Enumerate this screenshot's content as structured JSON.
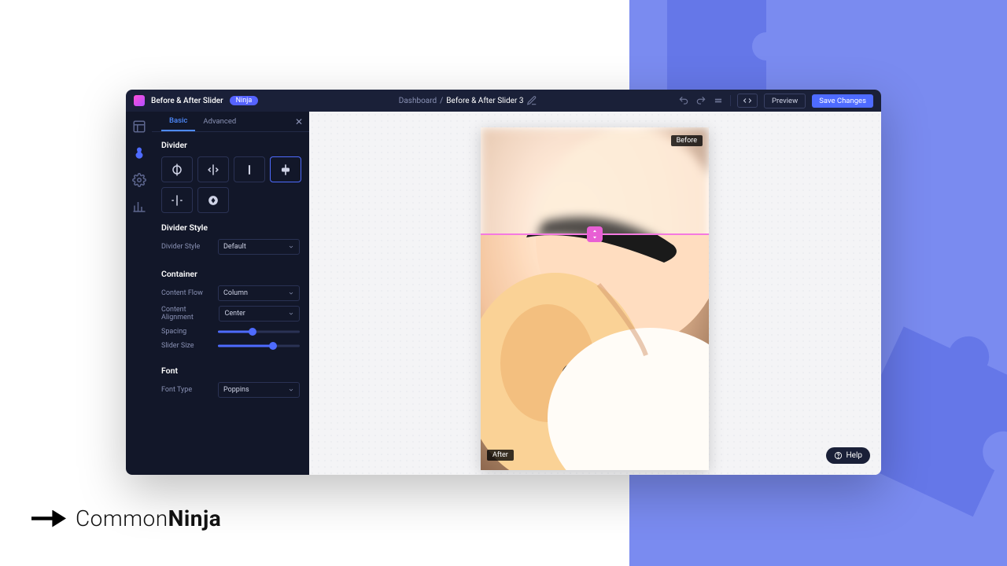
{
  "app": {
    "title": "Before & After Slider",
    "tag": "Ninja"
  },
  "breadcrumb": {
    "root": "Dashboard",
    "sep": "/",
    "current": "Before & After Slider 3"
  },
  "topbar": {
    "preview": "Preview",
    "save": "Save Changes"
  },
  "tabs": {
    "basic": "Basic",
    "advanced": "Advanced"
  },
  "panel": {
    "divider_title": "Divider",
    "divider_style_title": "Divider Style",
    "divider_style_label": "Divider Style",
    "divider_style_value": "Default",
    "container_title": "Container",
    "content_flow_label": "Content Flow",
    "content_flow_value": "Column",
    "content_alignment_label": "Content Alignment",
    "content_alignment_value": "Center",
    "spacing_label": "Spacing",
    "spacing_pct": 42,
    "slider_size_label": "Slider Size",
    "slider_size_pct": 67,
    "font_title": "Font",
    "font_type_label": "Font Type",
    "font_type_value": "Poppins",
    "divider_selected_index": 3
  },
  "preview": {
    "before_label": "Before",
    "after_label": "After",
    "handle_color": "#e85fd4"
  },
  "help": "Help",
  "brand": {
    "a": "Common",
    "b": "Ninja"
  },
  "colors": {
    "accent": "#4e6bff",
    "bg_right": "#7a8bf0",
    "bg_right_dark": "#6577e8",
    "panel_bg": "#121729",
    "topbar_bg": "#1a2038"
  }
}
